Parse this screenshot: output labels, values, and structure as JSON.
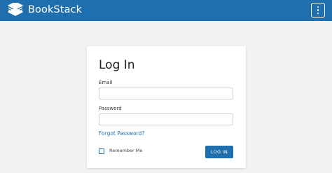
{
  "header": {
    "app_name": "BookStack",
    "logo_icon": "bookstack-logo-icon",
    "menu_icon": "vertical-dots-icon",
    "background_color": "#1f6fae"
  },
  "login": {
    "title": "Log In",
    "email_label": "Email",
    "email_value": "",
    "password_label": "Password",
    "password_value": "",
    "forgot_link": "Forgot Password?",
    "remember_label": "Remember Me",
    "remember_checked": false,
    "submit_label": "LOG IN",
    "accent_color": "#1f6fae"
  }
}
